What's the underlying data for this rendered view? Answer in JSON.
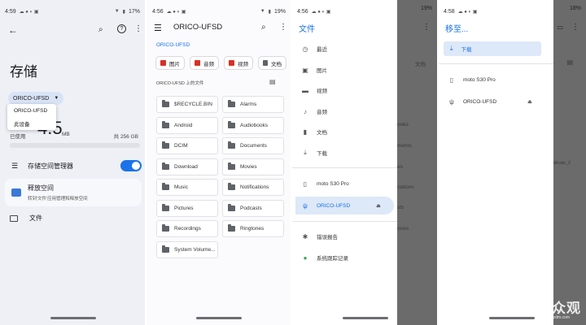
{
  "screen1": {
    "status_time": "4:59",
    "status_battery": "17%",
    "title": "存储",
    "dropdown_value": "ORICO-UFSD",
    "dropdown_options": [
      "ORICO-UFSD",
      "此设备"
    ],
    "used_number": "4.5",
    "used_unit": "MB",
    "used_label": "已使用",
    "total_label": "共 256 GB",
    "storage_manager_label": "存储空间管理器",
    "free_space_title": "释放空间",
    "free_space_desc": "转到'文件'应用管理和释放空间",
    "files_label": "文件"
  },
  "screen2": {
    "status_time": "4:56",
    "status_battery": "19%",
    "title": "ORICO-UFSD",
    "breadcrumb": "ORICO-UFSD",
    "chips": [
      "图片",
      "音频",
      "视频",
      "文档"
    ],
    "section_label": "ORICO-UFSD 上的文件",
    "folders": [
      "$RECYCLE.BIN",
      "Alarms",
      "Android",
      "Audiobooks",
      "DCIM",
      "Documents",
      "Download",
      "Movies",
      "Music",
      "Notifications",
      "Pictures",
      "Podcasts",
      "Recordings",
      "Ringtones",
      "System Volume..."
    ]
  },
  "screen3": {
    "status_time": "4:56",
    "status_battery": "19%",
    "drawer_title": "文件",
    "items": [
      "最近",
      "图片",
      "视频",
      "音频",
      "文档",
      "下载"
    ],
    "device_1": "moto S30 Pro",
    "device_2": "ORICO-UFSD",
    "bug_report": "错误报告",
    "system_log": "系统跟踪记录",
    "behind_texts": [
      "文档",
      "ooks",
      "ments",
      "es",
      "cations",
      "sts",
      "ones"
    ]
  },
  "screen4": {
    "status_time": "4:58",
    "status_battery": "18%",
    "title": "移至...",
    "downloads_label": "下载",
    "device_1": "moto S30 Pro",
    "device_2": "ORICO-UFSD",
    "behind_text": "ttitude_2",
    "watermark": "新众观",
    "watermark_sub": "www.smzdm.com"
  },
  "colors": {
    "accent": "#1a73e8",
    "scrim": "#6b6b6b",
    "panel1_bg": "#eef0f6"
  }
}
